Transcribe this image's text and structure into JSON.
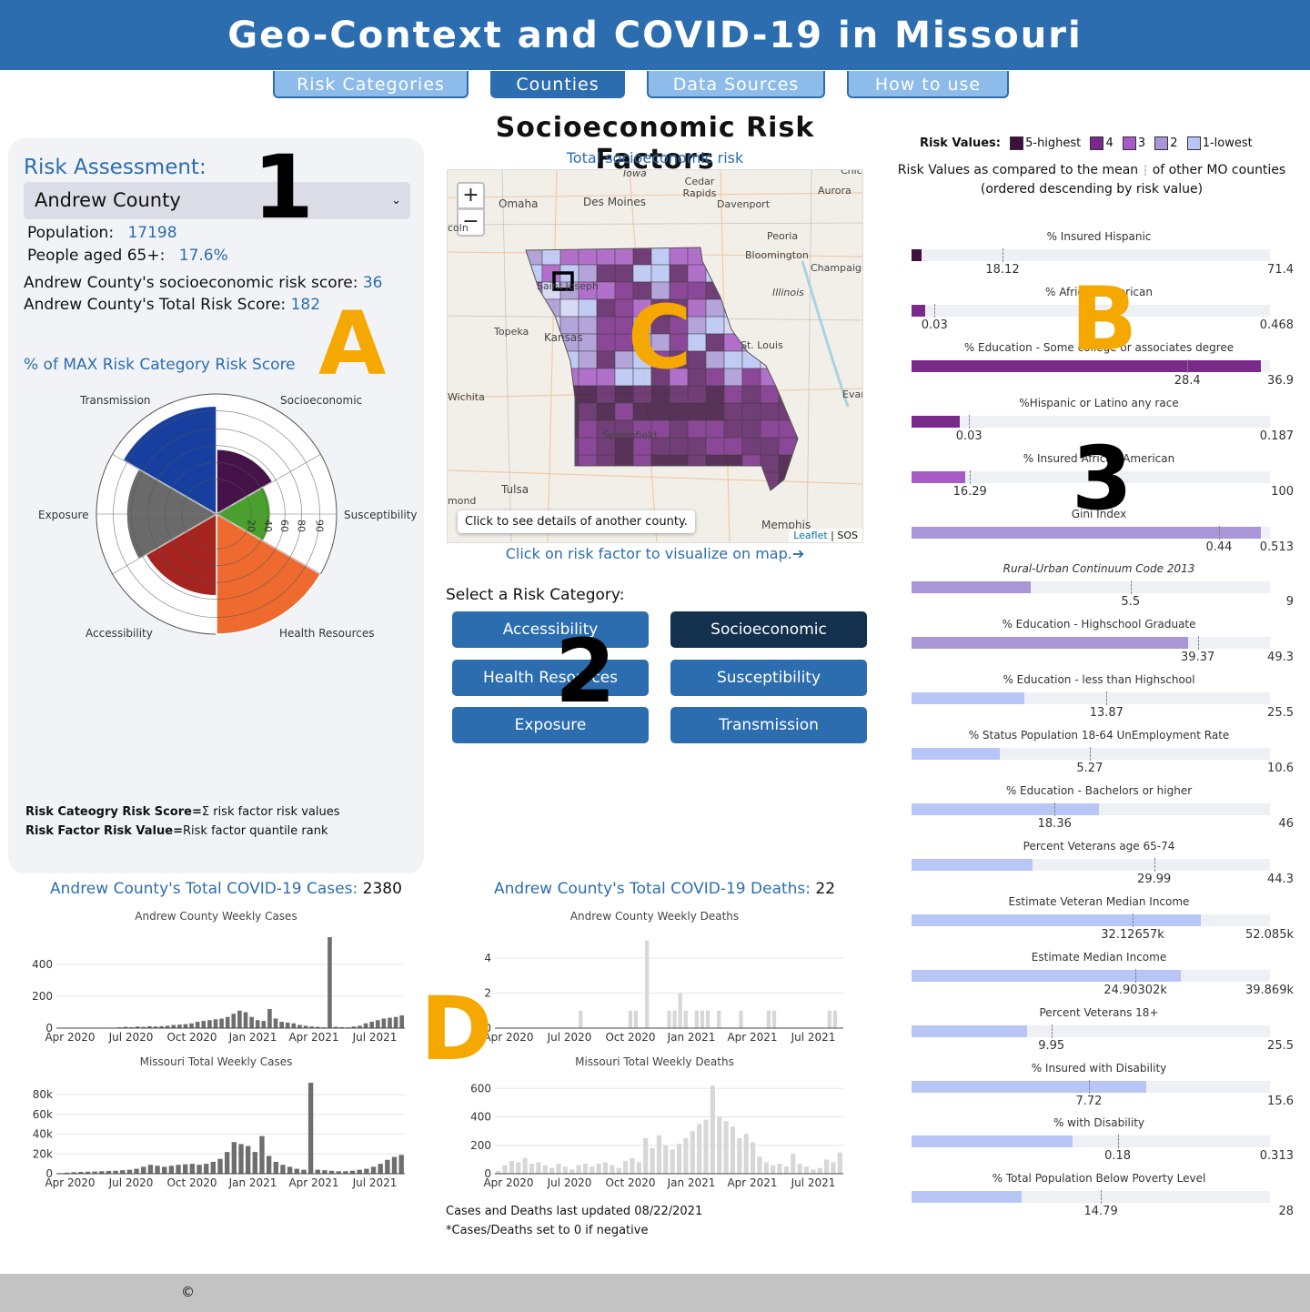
{
  "header": {
    "title": "Geo-Context and COVID-19 in Missouri"
  },
  "tabs": [
    {
      "label": "Risk Categories",
      "active": false
    },
    {
      "label": "Counties",
      "active": true
    },
    {
      "label": "Data Sources",
      "active": false
    },
    {
      "label": "How to use",
      "active": false
    }
  ],
  "overlays": {
    "n1": "1",
    "n2": "2",
    "n3": "3",
    "lA": "A",
    "lB": "B",
    "lC": "C",
    "lD": "D"
  },
  "assessment": {
    "heading": "Risk Assessment:",
    "selected_county": "Andrew County",
    "population_label": "Population:",
    "population_value": "17198",
    "aged_label": "People aged 65+:",
    "aged_value": "17.6%",
    "socio_label": "Andrew County's socioeconomic risk score:",
    "socio_value": "36",
    "total_label": "Andrew County's Total Risk Score:",
    "total_value": "182",
    "radar_title": "% of MAX Risk Category Risk Score",
    "footnote_1_bold": "Risk Cateogry Risk Score=",
    "footnote_1_rest": "Σ risk factor risk values",
    "footnote_2_bold": "Risk Factor Risk Value=",
    "footnote_2_rest": "Risk factor quantile rank"
  },
  "radar": {
    "categories": [
      {
        "name": "Socioeconomic",
        "value": 54,
        "color": "#45134a"
      },
      {
        "name": "Susceptibility",
        "value": 45,
        "color": "#4aa02c"
      },
      {
        "name": "Health Resources",
        "value": 100,
        "color": "#ee6a2f"
      },
      {
        "name": "Accessibility",
        "value": 68,
        "color": "#a5241f"
      },
      {
        "name": "Exposure",
        "value": 75,
        "color": "#6a6a6a"
      },
      {
        "name": "Transmission",
        "value": 90,
        "color": "#163fa0"
      }
    ],
    "ticks": [
      "20",
      "40",
      "60",
      "80",
      "90"
    ]
  },
  "center": {
    "title": "Socioeconomic Risk Factors",
    "map_subtitle": "Total socioeconomic risk",
    "tooltip": "Click to see details of another county.",
    "attribution_link": "Leaflet",
    "attribution_rest": "| SOS",
    "click_hint": "Click on risk factor to visualize on map.➔",
    "select_label": "Select a Risk Category:",
    "buttons": [
      {
        "label": "Accessibility",
        "active": false
      },
      {
        "label": "Socioeconomic",
        "active": true
      },
      {
        "label": "Health Resources",
        "active": false
      },
      {
        "label": "Susceptibility",
        "active": false
      },
      {
        "label": "Exposure",
        "active": false
      },
      {
        "label": "Transmission",
        "active": false
      }
    ],
    "map_places": [
      "Iowa",
      "Cedar Rapids",
      "Chica",
      "Omaha",
      "Des Moines",
      "Davenport",
      "Aurora",
      "coln",
      "Peoria",
      "Bloomington",
      "Champaign",
      "Illinois",
      "Topeka",
      "Kansas",
      "Saint Joseph",
      "St. Louis",
      "Wichita",
      "Evan",
      "Tulsa",
      "Springfield",
      "Memphis",
      "mond"
    ],
    "zoom_in": "+",
    "zoom_out": "−"
  },
  "risk_panel": {
    "legend_label": "Risk Values:",
    "legend": [
      {
        "label": "5-highest",
        "color": "#3d1040"
      },
      {
        "label": "4",
        "color": "#7a2a8a"
      },
      {
        "label": "3",
        "color": "#a65bc5"
      },
      {
        "label": "2",
        "color": "#a896d6"
      },
      {
        "label": "1-lowest",
        "color": "#b8c6f7"
      }
    ],
    "desc_1a": "Risk Values as compared to the mean",
    "desc_1b": "of other MO counties",
    "desc_2": "(ordered descending by risk value)"
  },
  "chart_data": [
    {
      "type": "bar",
      "title": "Risk factor values",
      "series": [
        {
          "name": "% Insured Hispanic",
          "value": 2,
          "mean": "18.12",
          "max": "71.4",
          "risk": 5
        },
        {
          "name": "% African American",
          "value": 0.018,
          "mean": "0.03",
          "max": "0.468",
          "risk": 4
        },
        {
          "name": "% Education  - Some college or associates degree",
          "value": 36,
          "mean": "28.4",
          "max": "36.9",
          "risk": 4
        },
        {
          "name": "%Hispanic or Latino any race",
          "value": 0.025,
          "mean": "0.03",
          "max": "0.187",
          "risk": 4
        },
        {
          "name": "% Insured African American",
          "value": 15,
          "mean": "16.29",
          "max": "100",
          "risk": 3
        },
        {
          "name": "Gini Index",
          "value": 0.5,
          "mean": "0.44",
          "max": "0.513",
          "risk": 2
        },
        {
          "name": "Rural-Urban Continuum Code 2013",
          "value": 3,
          "mean": "5.5",
          "max": "9",
          "risk": 2,
          "italic": true
        },
        {
          "name": "% Education - Highschool Graduate",
          "value": 38,
          "mean": "39.37",
          "max": "49.3",
          "risk": 2
        },
        {
          "name": "% Education - less than Highschool",
          "value": 8,
          "mean": "13.87",
          "max": "25.5",
          "risk": 1
        },
        {
          "name": "% Status Population 18-64 UnEmployment Rate",
          "value": 2.6,
          "mean": "5.27",
          "max": "10.6",
          "risk": 1
        },
        {
          "name": "% Education - Bachelors or higher",
          "value": 24,
          "mean": "18.36",
          "max": "46",
          "risk": 1
        },
        {
          "name": "Percent Veterans age 65-74",
          "value": 15,
          "mean": "29.99",
          "max": "44.3",
          "risk": 1
        },
        {
          "name": "Estimate Veteran Median Income",
          "value": 42,
          "mean": "32.12657k",
          "max": "52.085k",
          "risk": 1
        },
        {
          "name": "Estimate Median Income",
          "value": 30,
          "mean": "24.90302k",
          "max": "39.869k",
          "risk": 1
        },
        {
          "name": "Percent Veterans 18+",
          "value": 8.2,
          "mean": "9.95",
          "max": "25.5",
          "risk": 1
        },
        {
          "name": "% Insured with Disability",
          "value": 10.2,
          "mean": "7.72",
          "max": "15.6",
          "risk": 1
        },
        {
          "name": "% with Disability",
          "value": 0.141,
          "mean": "0.18",
          "max": "0.313",
          "risk": 1
        },
        {
          "name": "% Total Population Below Poverty Level",
          "value": 8.6,
          "mean": "14.79",
          "max": "28",
          "risk": 1
        }
      ]
    },
    {
      "type": "bar",
      "title": "Andrew County Weekly Cases",
      "x_ticks": [
        "Apr 2020",
        "Jul 2020",
        "Oct 2020",
        "Jan 2021",
        "Apr 2021",
        "Jul 2021"
      ],
      "y_ticks": [
        "0",
        "200",
        "400"
      ],
      "ylim": [
        0,
        570
      ],
      "values": [
        0,
        0,
        0,
        0,
        0,
        0,
        0,
        0,
        2,
        3,
        5,
        8,
        6,
        10,
        8,
        12,
        10,
        12,
        15,
        20,
        22,
        25,
        30,
        40,
        45,
        50,
        55,
        60,
        70,
        90,
        110,
        100,
        70,
        50,
        45,
        120,
        60,
        40,
        35,
        30,
        20,
        15,
        10,
        8,
        5,
        570,
        8,
        6,
        5,
        10,
        15,
        30,
        40,
        50,
        60,
        65,
        70,
        80
      ],
      "color": "#6e6e6e"
    },
    {
      "type": "bar",
      "title": "Missouri Total Weekly Cases",
      "x_ticks": [
        "Apr 2020",
        "Jul 2020",
        "Oct 2020",
        "Jan 2021",
        "Apr 2021",
        "Jul 2021"
      ],
      "y_ticks": [
        "0",
        "20k",
        "40k",
        "60k",
        "80k"
      ],
      "ylim": [
        0,
        92000
      ],
      "values": [
        500,
        1000,
        1500,
        1800,
        2000,
        2200,
        2500,
        2800,
        3000,
        3500,
        4000,
        5000,
        7000,
        9000,
        8000,
        7000,
        8000,
        9000,
        9500,
        10000,
        9000,
        10000,
        12000,
        15000,
        22000,
        32000,
        30000,
        28000,
        22000,
        38000,
        18000,
        12000,
        9000,
        7000,
        5000,
        4000,
        92000,
        4000,
        3500,
        3000,
        2500,
        2500,
        3000,
        4000,
        5000,
        7000,
        10000,
        14000,
        17000,
        19000
      ],
      "color": "#6e6e6e"
    },
    {
      "type": "bar",
      "title": "Andrew County Weekly Deaths",
      "x_ticks": [
        "Apr 2020",
        "Jul 2020",
        "Oct 2020",
        "Jan 2021",
        "Apr 2021",
        "Jul 2021"
      ],
      "y_ticks": [
        "0",
        "2",
        "4"
      ],
      "ylim": [
        0,
        5.2
      ],
      "values": [
        0,
        0,
        0,
        0,
        0,
        0,
        0,
        0,
        0,
        0,
        0,
        0,
        0,
        0,
        0,
        1,
        0,
        0,
        0,
        0,
        0,
        0,
        0,
        0,
        1,
        1,
        0,
        5,
        0,
        0,
        0,
        1,
        1,
        2,
        1,
        0,
        1,
        1,
        1,
        0,
        1,
        0,
        0,
        0,
        1,
        0,
        0,
        0,
        0,
        1,
        1,
        0,
        0,
        0,
        0,
        0,
        0,
        0,
        0,
        0,
        1,
        1,
        0
      ],
      "color": "#d7d7d7"
    },
    {
      "type": "bar",
      "title": "Missouri Total Weekly Deaths",
      "x_ticks": [
        "Apr 2020",
        "Jul 2020",
        "Oct 2020",
        "Jan 2021",
        "Apr 2021",
        "Jul 2021"
      ],
      "y_ticks": [
        "0",
        "200",
        "400",
        "600"
      ],
      "ylim": [
        0,
        640
      ],
      "values": [
        20,
        60,
        90,
        80,
        110,
        70,
        80,
        60,
        40,
        70,
        50,
        30,
        60,
        70,
        50,
        70,
        80,
        60,
        40,
        90,
        110,
        80,
        250,
        180,
        270,
        200,
        170,
        210,
        250,
        300,
        350,
        380,
        620,
        400,
        370,
        330,
        250,
        280,
        220,
        120,
        80,
        60,
        70,
        50,
        140,
        70,
        50,
        30,
        40,
        100,
        80,
        150
      ],
      "color": "#d7d7d7"
    }
  ],
  "covid": {
    "cases_label": "Andrew County's Total COVID-19 Cases:",
    "cases_value": "2380",
    "deaths_label": "Andrew County's Total COVID-19 Deaths:",
    "deaths_value": "22",
    "updated": "Cases and Deaths last updated 08/22/2021",
    "note": "*Cases/Deaths set to 0 if negative"
  },
  "footer": {
    "copyright": "©"
  }
}
